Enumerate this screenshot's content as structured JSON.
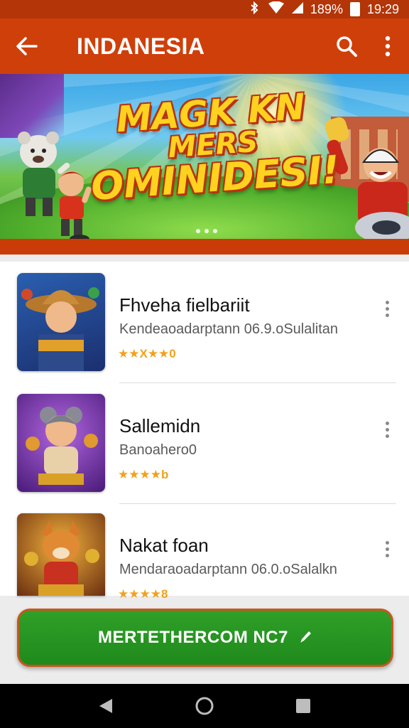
{
  "status_bar": {
    "battery_text": "189%",
    "time": "19:29"
  },
  "app_bar": {
    "title": "INDANESIA",
    "icons": [
      "back-arrow-icon",
      "search-icon",
      "more-vert-icon"
    ]
  },
  "banner": {
    "headline_line1": "MAGK KN",
    "headline_line2": "MERS",
    "headline_line3": "OMINIDESI!",
    "page_indicator_count": 3
  },
  "apps": [
    {
      "name": "Fhveha fielbariit",
      "subtitle": "Kendeaoadarptann 06.9.oSulalitan",
      "rating_text": "★★X★★0"
    },
    {
      "name": "Sallemidn",
      "subtitle": "Banoahe­ro0",
      "rating_text": "★★★★b"
    },
    {
      "name": "Nakat foan",
      "subtitle": "Mendaraoadarptann 06.0.oSalalkn",
      "rating_text": "★★★★8"
    }
  ],
  "cta": {
    "label": "MERTETHERCOM NC7",
    "icon": "pencil-icon"
  },
  "colors": {
    "app_bar": "#cf3f0a",
    "status_bar": "#b33508",
    "cta_green": "#1f8a1c",
    "rating_star": "#f2a11b"
  },
  "nav_bar": {
    "icons": [
      "back-triangle-icon",
      "home-circle-icon",
      "recents-square-icon"
    ]
  }
}
